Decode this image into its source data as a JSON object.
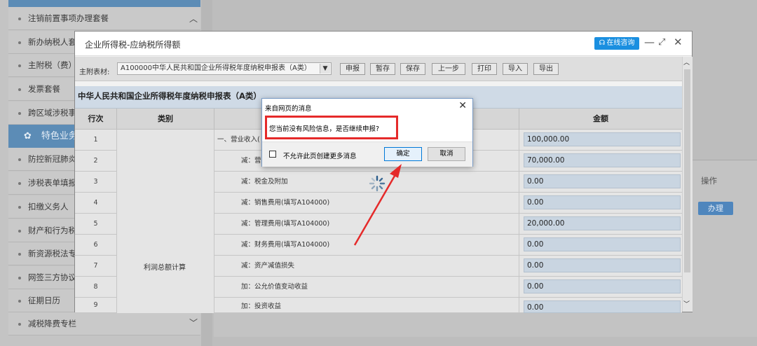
{
  "sidebar": {
    "items": [
      {
        "label": "注销前置事项办理套餐"
      },
      {
        "label": "新办纳税人套"
      },
      {
        "label": "主附税（费）"
      },
      {
        "label": "发票套餐"
      },
      {
        "label": "跨区域涉税事"
      },
      {
        "label": "特色业务"
      },
      {
        "label": "防控新冠肺炎"
      },
      {
        "label": "涉税表单填报"
      },
      {
        "label": "扣缴义务人"
      },
      {
        "label": "财产和行为税"
      },
      {
        "label": "新资源税法专"
      },
      {
        "label": "网签三方协议"
      },
      {
        "label": "征期日历"
      },
      {
        "label": "减税降费专栏"
      }
    ]
  },
  "background": {
    "op_header": "操作",
    "op_button": "办理"
  },
  "window": {
    "title": "企业所得税-应纳税所得额",
    "consult_label": "在线咨询",
    "toolbar": {
      "label": "主附表材:",
      "selected_form": "A100000中华人民共和国企业所得税年度纳税申报表（A类）",
      "buttons": [
        "申报",
        "暂存",
        "保存",
        "上一步",
        "打印",
        "导入",
        "导出"
      ]
    },
    "report_title": "中华人民共和国企业所得税年度纳税申报表（A类）",
    "table": {
      "headers": {
        "row_no": "行次",
        "category": "类别",
        "item": "",
        "amount": "金额"
      },
      "category_label": "利润总额计算",
      "rows": [
        {
          "no": "1",
          "item": "一、营业收入(",
          "amount": "100,000.00"
        },
        {
          "no": "2",
          "item": "减：营",
          "amount": "70,000.00"
        },
        {
          "no": "3",
          "item": "减：税金及附加",
          "amount": "0.00"
        },
        {
          "no": "4",
          "item": "减：销售费用(填写A104000)",
          "amount": "0.00"
        },
        {
          "no": "5",
          "item": "减：管理费用(填写A104000)",
          "amount": "20,000.00"
        },
        {
          "no": "6",
          "item": "减：财务费用(填写A104000)",
          "amount": "0.00"
        },
        {
          "no": "7",
          "item": "减：资产减值损失",
          "amount": "0.00"
        },
        {
          "no": "8",
          "item": "加：公允价值变动收益",
          "amount": "0.00"
        },
        {
          "no": "9",
          "item": "加：投资收益",
          "amount": "0.00"
        }
      ]
    }
  },
  "dialog": {
    "title": "来自网页的消息",
    "message": "您当前没有风险信息，是否继续申报?",
    "checkbox_label": "不允许此页创建更多消息",
    "ok_label": "确定",
    "cancel_label": "取消"
  },
  "colors": {
    "highlight_red": "#e52a2a",
    "sidebar_active": "#5c8cb6",
    "consult_blue": "#1a8fe0"
  }
}
